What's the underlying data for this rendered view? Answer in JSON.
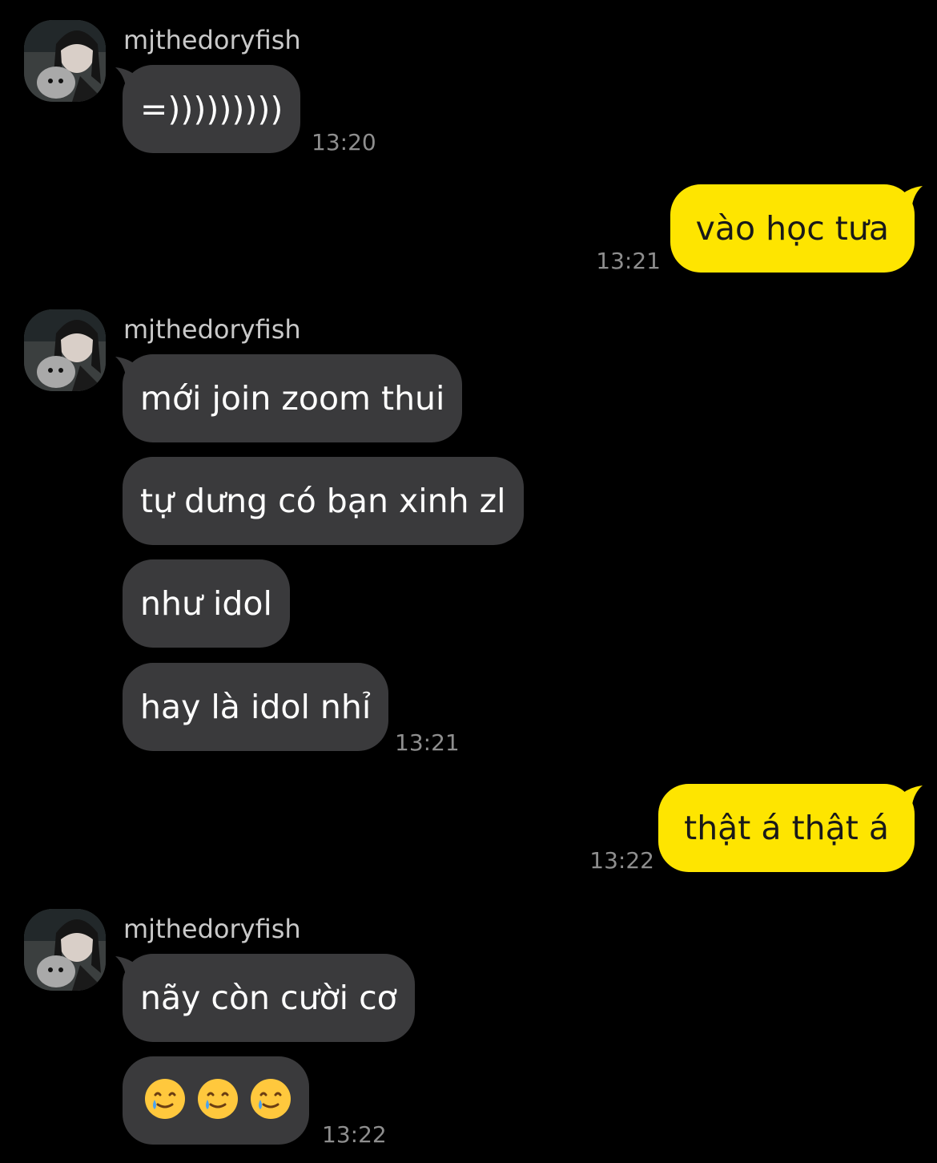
{
  "chat": {
    "sender_name": "mjthedoryfish",
    "avatar_label": "profile photo of mjthedoryfish",
    "colors": {
      "background": "#000000",
      "incoming_bubble": "#3a3a3c",
      "outgoing_bubble": "#fee500",
      "timestamp": "#8e8e8e"
    },
    "groups": [
      {
        "side": "incoming",
        "sender": "mjthedoryfish",
        "messages": [
          "=)))))))))"
        ],
        "time": "13:20"
      },
      {
        "side": "outgoing",
        "messages": [
          "vào học tưa"
        ],
        "time": "13:21"
      },
      {
        "side": "incoming",
        "sender": "mjthedoryfish",
        "messages": [
          "mới join zoom thui",
          "tự dưng có bạn xinh zl",
          "như idol",
          "hay là idol nhỉ"
        ],
        "time": "13:21"
      },
      {
        "side": "outgoing",
        "messages": [
          "thật á thật á"
        ],
        "time": "13:22"
      },
      {
        "side": "incoming",
        "sender": "mjthedoryfish",
        "messages": [
          "nãy còn cười cơ"
        ],
        "emoji_message": {
          "icon": "smiling-face-with-tear-icon",
          "count": 3
        },
        "time": "13:22"
      }
    ]
  }
}
